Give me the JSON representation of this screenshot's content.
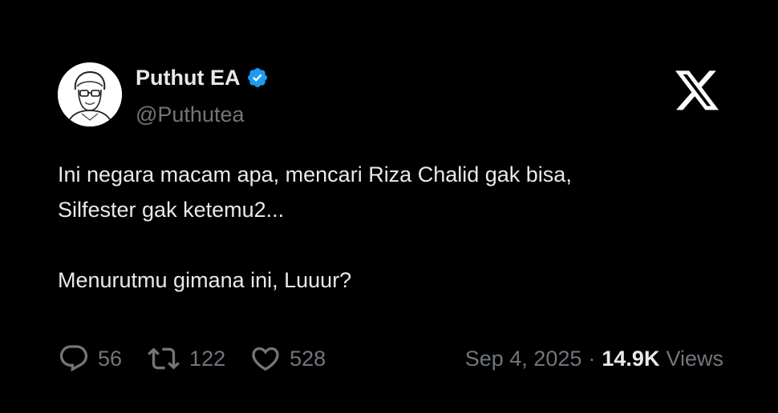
{
  "author": {
    "display_name": "Puthut EA",
    "handle": "@Puthutea",
    "verified": true,
    "verified_color": "#1d9bf0"
  },
  "tweet": {
    "lines": [
      "Ini negara macam apa, mencari Riza Chalid gak bisa,",
      "Silfester gak ketemu2...",
      "Menurutmu gimana ini, Luuur?"
    ]
  },
  "stats": {
    "replies": "56",
    "retweets": "122",
    "likes": "528"
  },
  "meta": {
    "date": "Sep 4, 2025",
    "separator": "·",
    "views_count": "14.9K",
    "views_label": "Views"
  },
  "icons": {
    "brand": "x-logo-icon",
    "verified": "verified-badge-icon",
    "reply": "reply-icon",
    "retweet": "retweet-icon",
    "like": "like-icon"
  },
  "colors": {
    "background": "#000000",
    "text_primary": "#e7e9ea",
    "text_secondary": "#71767b"
  }
}
